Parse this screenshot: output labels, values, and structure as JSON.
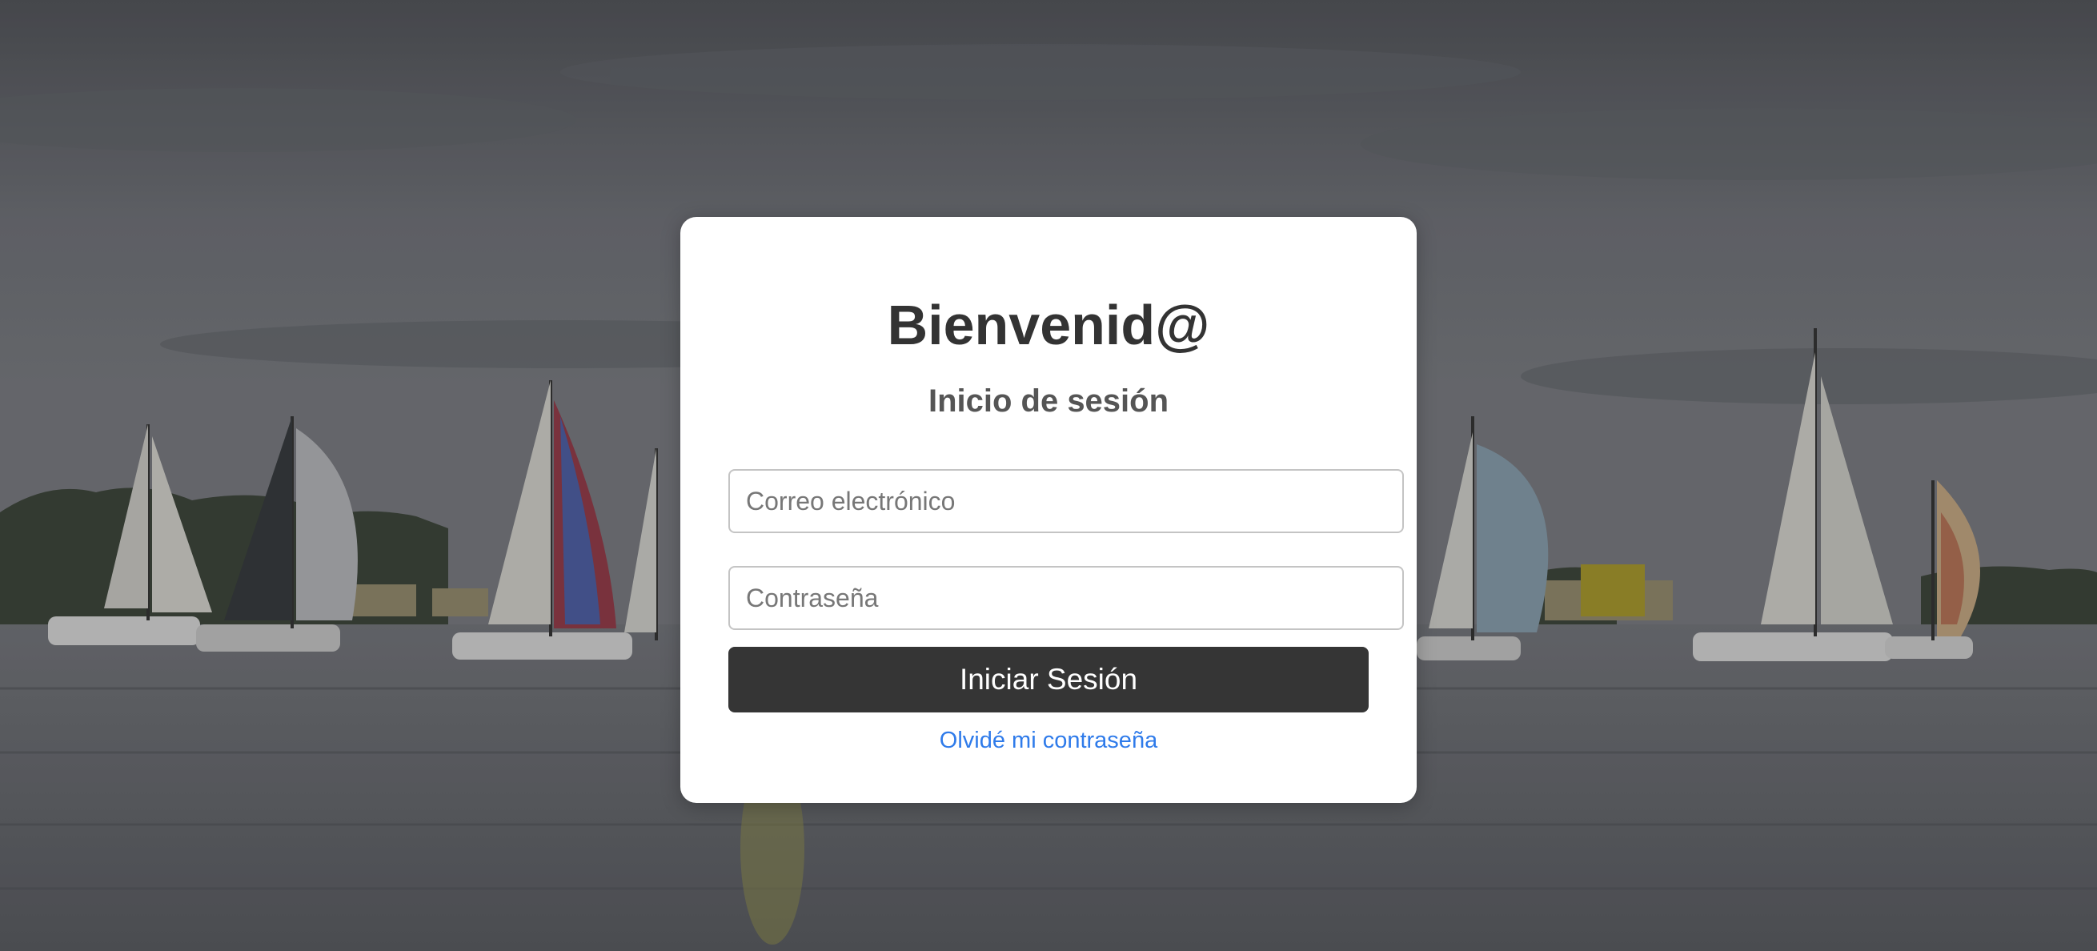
{
  "login": {
    "title": "Bienvenid@",
    "subtitle": "Inicio de sesión",
    "email_placeholder": "Correo electrónico",
    "password_placeholder": "Contraseña",
    "submit_label": "Iniciar Sesión",
    "forgot_label": "Olvidé mi contraseña"
  },
  "colors": {
    "card_bg": "#ffffff",
    "button_bg": "#353535",
    "link": "#2f7bea",
    "title": "#333333"
  },
  "background": {
    "description_icon": "sailboats-photo"
  }
}
